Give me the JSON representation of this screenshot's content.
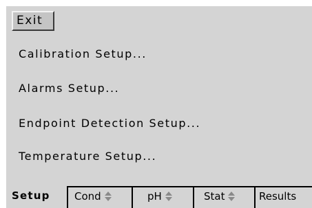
{
  "menu": {
    "exit_label": "Exit",
    "items": [
      {
        "label": "Calibration Setup..."
      },
      {
        "label": "Alarms Setup..."
      },
      {
        "label": "Endpoint Detection Setup..."
      },
      {
        "label": "Temperature Setup..."
      }
    ]
  },
  "tabs": [
    {
      "label": "Setup",
      "active": true
    },
    {
      "label": "Cond",
      "has_arrows": true
    },
    {
      "label": "pH",
      "has_arrows": true
    },
    {
      "label": "Stat",
      "has_arrows": true
    },
    {
      "label": "Results"
    }
  ],
  "colors": {
    "panel": "#d4d4d4",
    "button_face": "#c4c4c4",
    "text": "#000000"
  }
}
